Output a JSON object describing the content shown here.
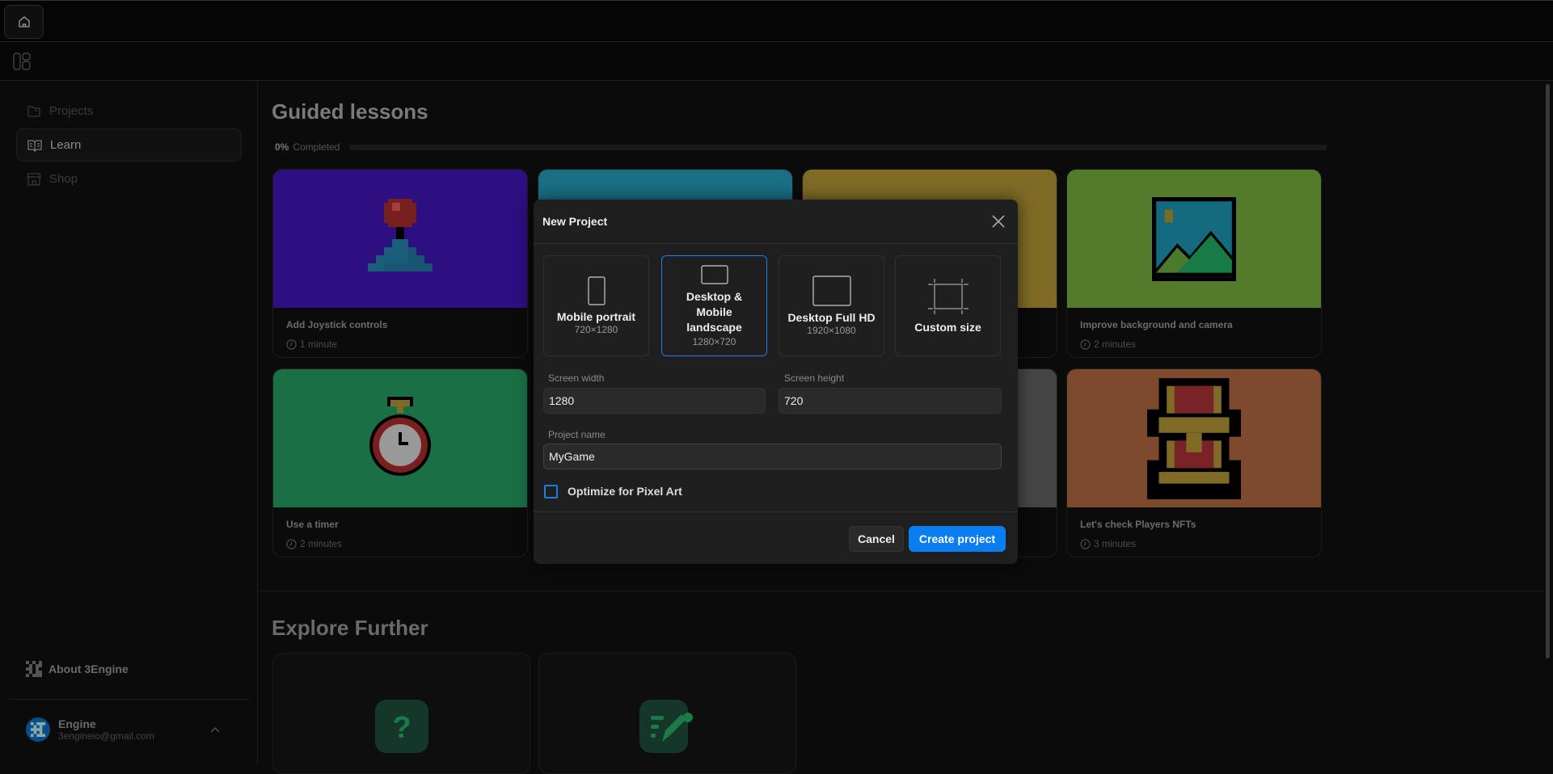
{
  "topbar": {
    "home_icon": "home-icon",
    "layout_icon": "layout-icon"
  },
  "sidebar": {
    "items": [
      {
        "label": "Projects",
        "icon": "folder-icon",
        "active": false
      },
      {
        "label": "Learn",
        "icon": "book-icon",
        "active": true
      },
      {
        "label": "Shop",
        "icon": "store-icon",
        "active": false
      }
    ],
    "about": "About 3Engine",
    "user": {
      "name": "Engine",
      "email": "3engineio@gmail.com"
    }
  },
  "main": {
    "title": "Guided lessons",
    "progress": {
      "percent_label": "0%",
      "label": "Completed",
      "value": 0
    },
    "lessons": [
      {
        "title": "Add Joystick controls",
        "duration": "1 minute",
        "color": "#2d0f82"
      },
      {
        "title": "",
        "duration": "",
        "color": "#1a6f85"
      },
      {
        "title": "",
        "duration": "",
        "color": "#7f6b25"
      },
      {
        "title": "Improve background and camera",
        "duration": "2 minutes",
        "color": "#547a2b"
      },
      {
        "title": "Use a timer",
        "duration": "2 minutes",
        "color": "#1a6f45"
      },
      {
        "title": "",
        "duration": "",
        "color": "#2a2a2a"
      },
      {
        "title": "",
        "duration": "",
        "color": "#454545"
      },
      {
        "title": "Let's check Players NFTs",
        "duration": "3 minutes",
        "color": "#7e4a2e"
      }
    ],
    "explore_title": "Explore Further"
  },
  "modal": {
    "title": "New Project",
    "options": [
      {
        "label": "Mobile portrait",
        "size": "720×1280",
        "selected": false
      },
      {
        "label": "Desktop & Mobile landscape",
        "size": "1280×720",
        "selected": true
      },
      {
        "label": "Desktop Full HD",
        "size": "1920×1080",
        "selected": false
      },
      {
        "label": "Custom size",
        "size": "",
        "selected": false
      }
    ],
    "width_label": "Screen width",
    "width_value": "1280",
    "height_label": "Screen height",
    "height_value": "720",
    "name_label": "Project name",
    "name_value": "MyGame",
    "pixel_art_label": "Optimize for Pixel Art",
    "pixel_art_checked": false,
    "cancel": "Cancel",
    "create": "Create project",
    "accent": "#0a7ef0"
  }
}
